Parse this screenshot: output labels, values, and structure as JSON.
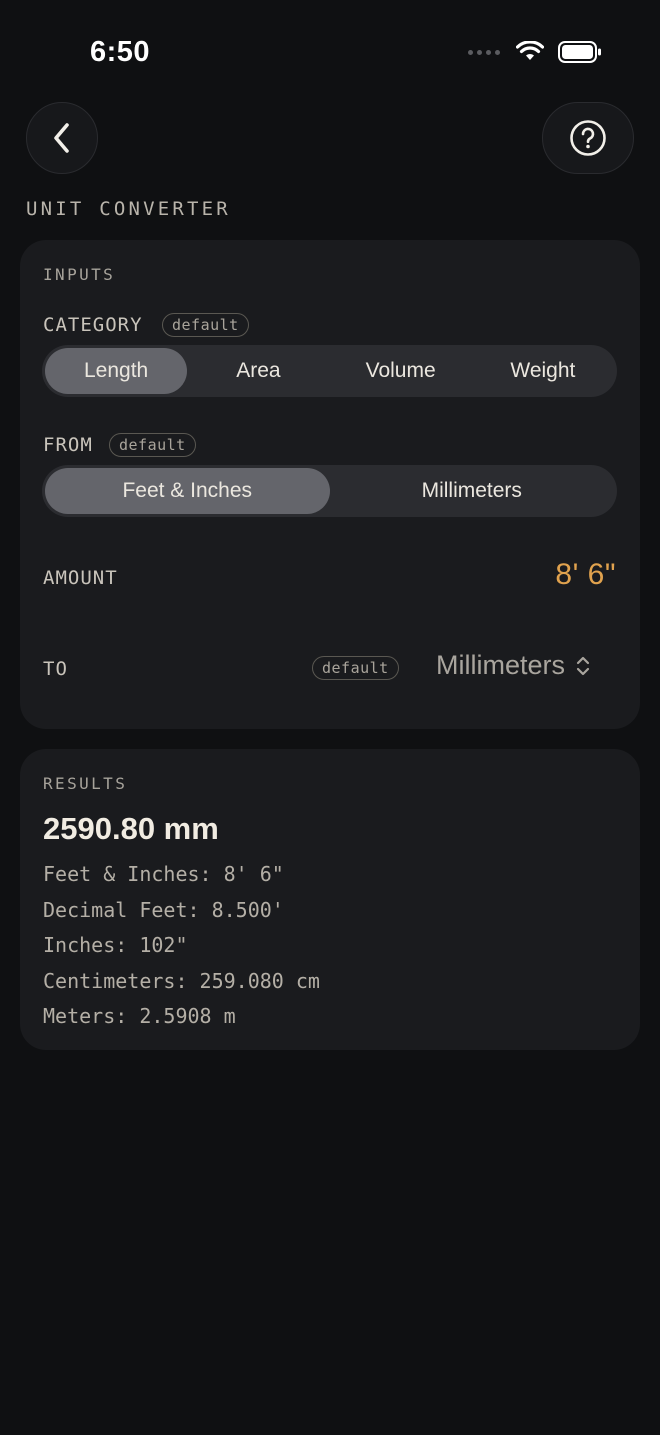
{
  "status_bar": {
    "time": "6:50"
  },
  "title": "UNIT CONVERTER",
  "inputs": {
    "section_label": "INPUTS",
    "category": {
      "label": "CATEGORY",
      "badge": "default",
      "options": [
        "Length",
        "Area",
        "Volume",
        "Weight"
      ],
      "selected": "Length"
    },
    "from": {
      "label": "FROM",
      "badge": "default",
      "options": [
        "Feet & Inches",
        "Millimeters"
      ],
      "selected": "Feet & Inches"
    },
    "amount": {
      "label": "AMOUNT",
      "value": "8' 6\""
    },
    "to": {
      "label": "TO",
      "badge": "default",
      "value": "Millimeters"
    }
  },
  "results": {
    "section_label": "RESULTS",
    "primary": "2590.80 mm",
    "lines": [
      "Feet & Inches: 8' 6\"",
      "Decimal Feet: 8.500'",
      "Inches: 102\"",
      "Centimeters: 259.080 cm",
      "Meters: 2.5908 m"
    ]
  },
  "colors": {
    "background": "#0f1012",
    "card": "#1a1b1e",
    "accent_amount": "#e0a24e",
    "segment_active": "#64656b"
  }
}
